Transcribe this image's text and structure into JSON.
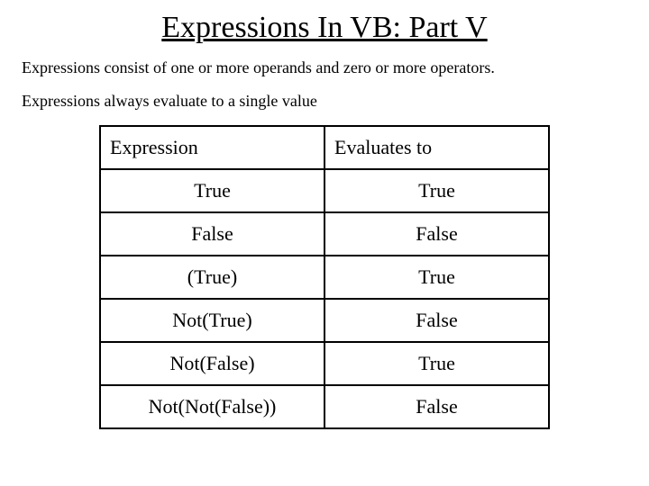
{
  "title": "Expressions In VB:  Part V",
  "paragraphs": [
    "Expressions consist of one or more operands and zero or more operators.",
    "Expressions always evaluate to a single value"
  ],
  "table": {
    "headers": [
      "Expression",
      "Evaluates to"
    ],
    "rows": [
      [
        "True",
        "True"
      ],
      [
        "False",
        "False"
      ],
      [
        "(True)",
        "True"
      ],
      [
        "Not(True)",
        "False"
      ],
      [
        "Not(False)",
        "True"
      ],
      [
        "Not(Not(False))",
        "False"
      ]
    ]
  },
  "chart_data": {
    "type": "table",
    "title": "Expressions In VB:  Part V",
    "columns": [
      "Expression",
      "Evaluates to"
    ],
    "rows": [
      [
        "True",
        "True"
      ],
      [
        "False",
        "False"
      ],
      [
        "(True)",
        "True"
      ],
      [
        "Not(True)",
        "False"
      ],
      [
        "Not(False)",
        "True"
      ],
      [
        "Not(Not(False))",
        "False"
      ]
    ]
  }
}
